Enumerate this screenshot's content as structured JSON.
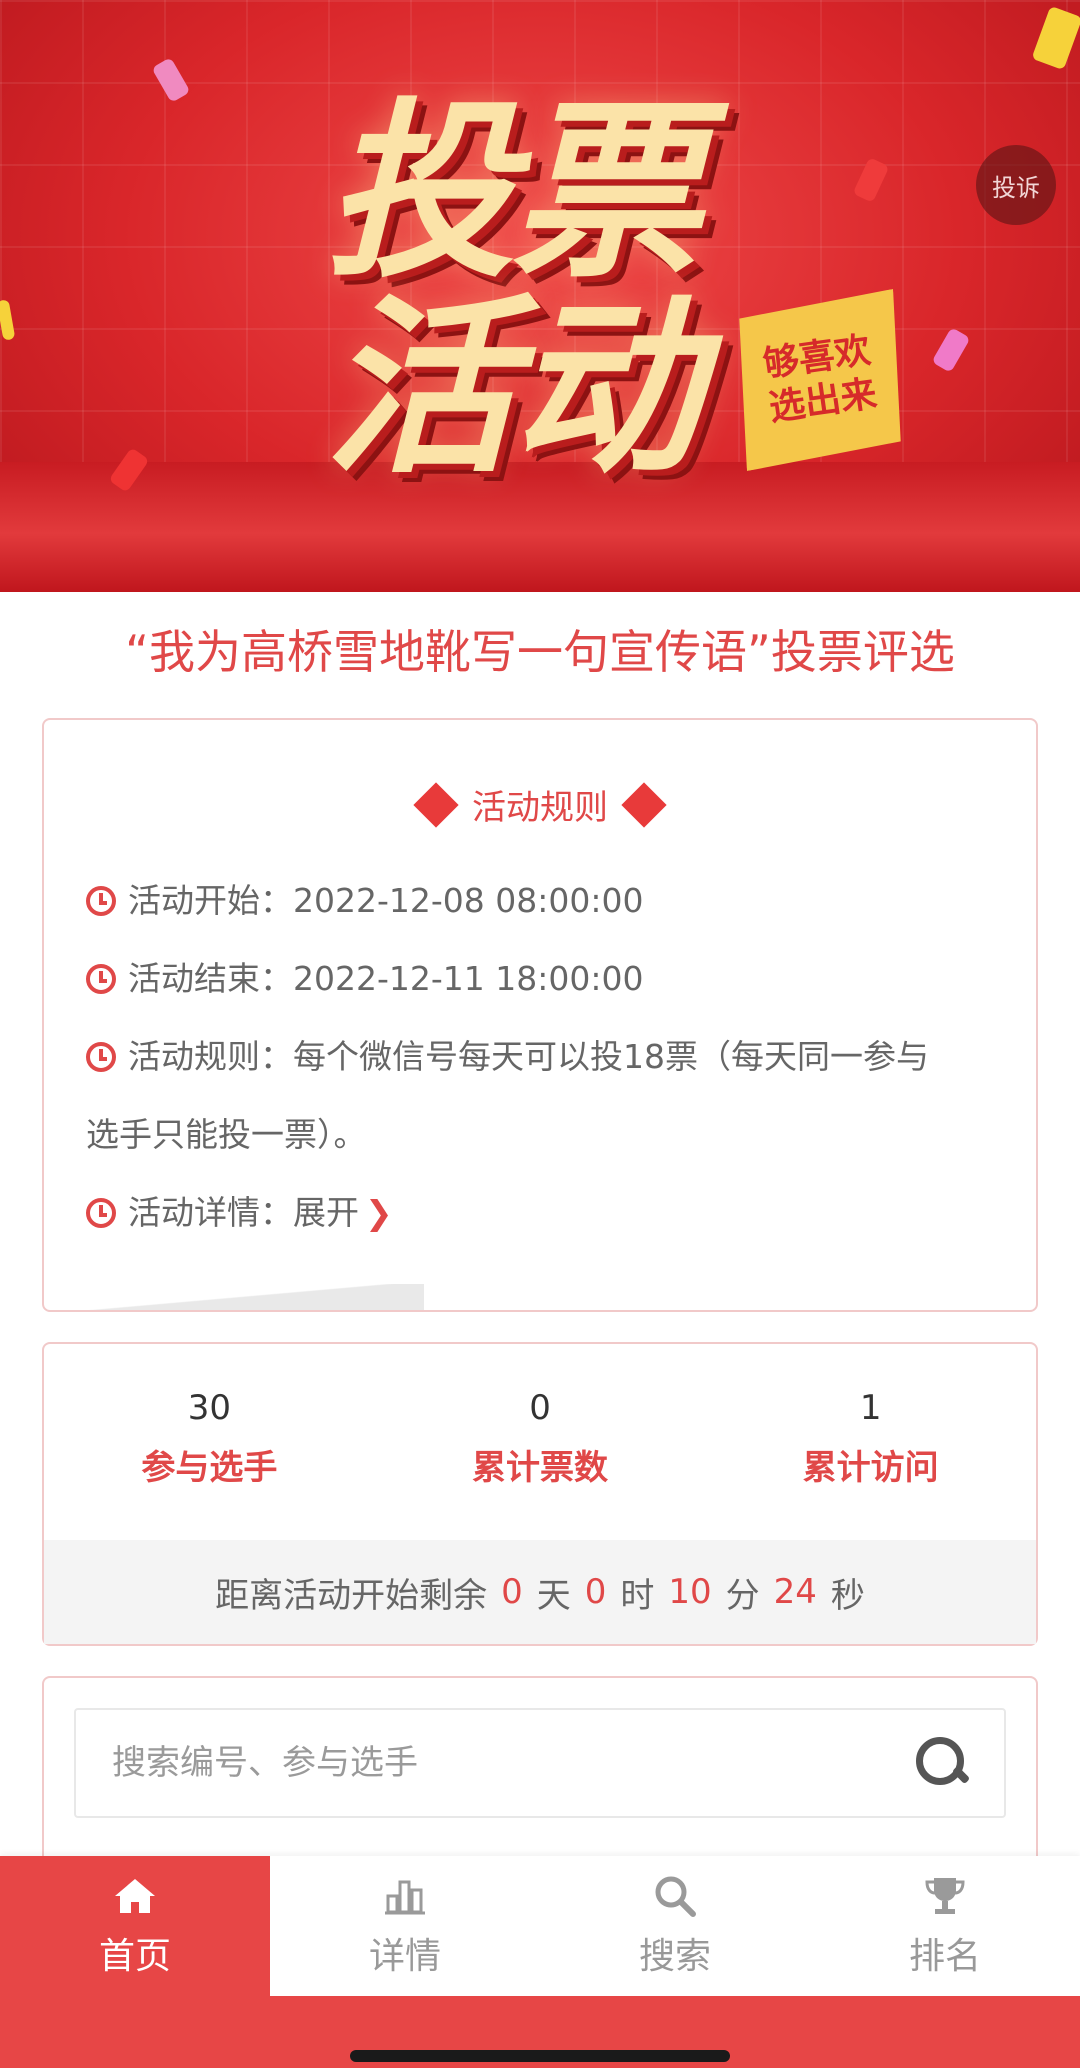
{
  "banner": {
    "title_line1": "投票",
    "title_line2": "活动",
    "badge": "够喜欢选出来",
    "complain_label": "投诉"
  },
  "event": {
    "title": "“我为高桥雪地靴写一句宣传语”投票评选"
  },
  "rules": {
    "heading": "活动规则",
    "start_label": "活动开始：2022-12-08 08:00:00",
    "end_label": "活动结束：2022-12-11 18:00:00",
    "rule_label": "活动规则：每个微信号每天可以投18票（每天同一参与",
    "rule_continued": "选手只能投一票）。",
    "details_label": "活动详情：展开"
  },
  "stats": {
    "participants_count": "30",
    "participants_label": "参与选手",
    "votes_count": "0",
    "votes_label": "累计票数",
    "visits_count": "1",
    "visits_label": "累计访问"
  },
  "countdown": {
    "prefix": "距离活动开始剩余",
    "days": "0",
    "days_unit": "天",
    "hours": "0",
    "hours_unit": "时",
    "minutes": "10",
    "minutes_unit": "分",
    "seconds": "24",
    "seconds_unit": "秒"
  },
  "search": {
    "placeholder": "搜索编号、参与选手"
  },
  "nav": {
    "items": [
      {
        "label": "首页",
        "icon": "home-icon",
        "active": true
      },
      {
        "label": "详情",
        "icon": "chart-icon",
        "active": false
      },
      {
        "label": "搜索",
        "icon": "search-icon",
        "active": false
      },
      {
        "label": "排名",
        "icon": "trophy-icon",
        "active": false
      }
    ]
  },
  "colors": {
    "accent": "#e04848",
    "nav_active": "#e74646",
    "banner": "#d9262a"
  }
}
